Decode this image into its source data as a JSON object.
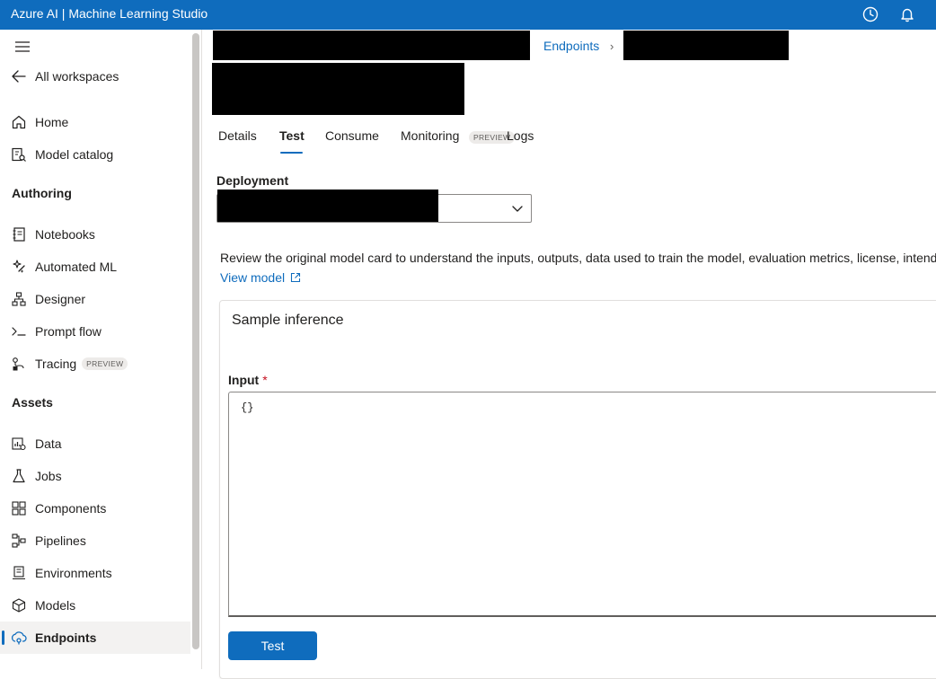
{
  "app": {
    "title": "Azure AI | Machine Learning Studio"
  },
  "colors": {
    "brand": "#0f6cbd",
    "topbar": "#0f6cbd",
    "required": "#c50f1f"
  },
  "topbar": {
    "icons": [
      "clock-icon",
      "bell-icon"
    ]
  },
  "sidebar": {
    "back": {
      "label": "All workspaces",
      "icon": "arrow-left-icon"
    },
    "items_top": [
      {
        "label": "Home",
        "icon": "home-icon"
      },
      {
        "label": "Model catalog",
        "icon": "model-catalog-icon"
      }
    ],
    "section_authoring": "Authoring",
    "items_authoring": [
      {
        "label": "Notebooks",
        "icon": "notebook-icon"
      },
      {
        "label": "Automated ML",
        "icon": "automl-icon"
      },
      {
        "label": "Designer",
        "icon": "designer-icon"
      },
      {
        "label": "Prompt flow",
        "icon": "prompt-flow-icon"
      },
      {
        "label": "Tracing",
        "icon": "tracing-icon",
        "badge": "PREVIEW"
      }
    ],
    "section_assets": "Assets",
    "items_assets": [
      {
        "label": "Data",
        "icon": "data-icon"
      },
      {
        "label": "Jobs",
        "icon": "jobs-icon"
      },
      {
        "label": "Components",
        "icon": "components-icon"
      },
      {
        "label": "Pipelines",
        "icon": "pipelines-icon"
      },
      {
        "label": "Environments",
        "icon": "environments-icon"
      },
      {
        "label": "Models",
        "icon": "models-icon"
      },
      {
        "label": "Endpoints",
        "icon": "endpoints-icon",
        "active": true
      }
    ]
  },
  "breadcrumb": {
    "endpoints": "Endpoints",
    "separator": "›"
  },
  "tabs": [
    {
      "label": "Details"
    },
    {
      "label": "Test",
      "active": true
    },
    {
      "label": "Consume"
    },
    {
      "label": "Monitoring",
      "badge": "PREVIEW"
    },
    {
      "label": "Logs"
    }
  ],
  "deployment": {
    "label": "Deployment"
  },
  "description": {
    "text": "Review the original model card to understand the inputs, outputs, data used to train the model, evaluation metrics, license, intended",
    "link": "View model"
  },
  "sample_inference": {
    "title": "Sample inference",
    "input_label": "Input",
    "required_mark": "*",
    "input_value": "{}",
    "test_button": "Test"
  }
}
